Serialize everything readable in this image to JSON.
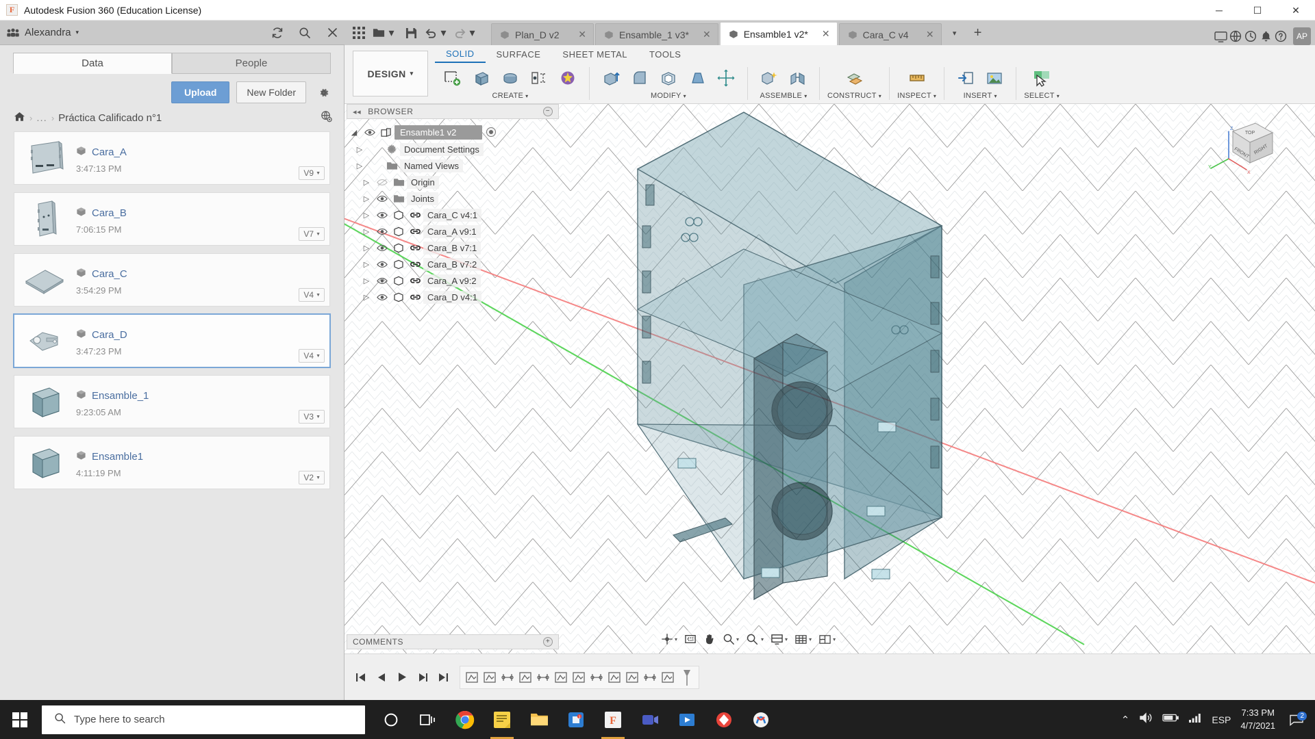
{
  "window": {
    "title": "Autodesk Fusion 360 (Education License)",
    "logo_glyph": "F",
    "minimize": "─",
    "maximize": "☐",
    "close": "✕"
  },
  "appbar": {
    "user_name": "Alexandra",
    "caret": "▾",
    "icons": [
      "refresh-icon",
      "search-icon",
      "close-icon"
    ]
  },
  "datapanel": {
    "tabs": [
      {
        "label": "Data",
        "active": true
      },
      {
        "label": "People",
        "active": false
      }
    ],
    "upload_label": "Upload",
    "new_folder_label": "New Folder",
    "settings_icon": "gear-icon",
    "breadcrumb": {
      "home_icon": "home-icon",
      "ellipsis": "...",
      "current": "Práctica Calificado n°1",
      "separator": "›"
    },
    "files": [
      {
        "name": "Cara_A",
        "time": "3:47:13 PM",
        "version": "V9",
        "selected": false,
        "thumb": "panel-a"
      },
      {
        "name": "Cara_B",
        "time": "7:06:15 PM",
        "version": "V7",
        "selected": false,
        "thumb": "panel-b"
      },
      {
        "name": "Cara_C",
        "time": "3:54:29 PM",
        "version": "V4",
        "selected": false,
        "thumb": "panel-c"
      },
      {
        "name": "Cara_D",
        "time": "3:47:23 PM",
        "version": "V4",
        "selected": true,
        "thumb": "panel-d"
      },
      {
        "name": "Ensamble_1",
        "time": "9:23:05 AM",
        "version": "V3",
        "selected": false,
        "thumb": "box"
      },
      {
        "name": "Ensamble1",
        "time": "4:11:19 PM",
        "version": "V2",
        "selected": false,
        "thumb": "box"
      }
    ]
  },
  "doctabs": {
    "items": [
      {
        "label": "Plan_D v2",
        "active": false,
        "closable": true
      },
      {
        "label": "Ensamble_1 v3*",
        "active": false,
        "closable": true
      },
      {
        "label": "Ensamble1 v2*",
        "active": true,
        "closable": true
      },
      {
        "label": "Cara_C v4",
        "active": false,
        "closable": true
      }
    ],
    "overflow_caret": "▾",
    "add_label": "+",
    "right_icons": [
      "job-status-icon",
      "help-globe-icon",
      "clock-icon",
      "bell-icon",
      "question-icon"
    ],
    "avatar_initials": "AP",
    "grid_icon": "apps-grid-icon",
    "new_icon": "new-design-icon",
    "save_icon": "save-icon",
    "undo_icon": "undo-icon",
    "redo_icon": "redo-icon"
  },
  "ribbon": {
    "workspace_label": "DESIGN",
    "workspace_caret": "▾",
    "tabs": [
      {
        "label": "SOLID",
        "active": true
      },
      {
        "label": "SURFACE",
        "active": false
      },
      {
        "label": "SHEET METAL",
        "active": false
      },
      {
        "label": "TOOLS",
        "active": false
      }
    ],
    "groups": [
      {
        "label": "CREATE",
        "caret": "▾",
        "icons": [
          "new-sketch-icon",
          "extrude-icon",
          "revolve-icon",
          "hole-icon",
          "create-more-icon"
        ]
      },
      {
        "label": "MODIFY",
        "caret": "▾",
        "icons": [
          "press-pull-icon",
          "fillet-icon",
          "shell-icon",
          "draft-icon",
          "move-copy-icon"
        ]
      },
      {
        "label": "ASSEMBLE",
        "caret": "▾",
        "icons": [
          "new-component-icon",
          "joint-icon"
        ]
      },
      {
        "label": "CONSTRUCT",
        "caret": "▾",
        "icons": [
          "offset-plane-icon"
        ]
      },
      {
        "label": "INSPECT",
        "caret": "▾",
        "icons": [
          "measure-icon"
        ]
      },
      {
        "label": "INSERT",
        "caret": "▾",
        "icons": [
          "insert-derive-icon",
          "insert-canvas-icon"
        ]
      },
      {
        "label": "SELECT",
        "caret": "▾",
        "icons": [
          "select-icon"
        ]
      }
    ]
  },
  "browser": {
    "title": "BROWSER",
    "collapse_icon": "◂◂",
    "minimize_glyph": "−",
    "root": {
      "label": "Ensamble1 v2",
      "icon": "assembly-icon",
      "expanded": true
    },
    "nodes": [
      {
        "label": "Document Settings",
        "icon": "gear-icon",
        "eye": false,
        "link": false,
        "indent": 1
      },
      {
        "label": "Named Views",
        "icon": "folder-icon",
        "eye": false,
        "link": false,
        "indent": 1
      },
      {
        "label": "Origin",
        "icon": "folder-icon",
        "eye": true,
        "eye_off": true,
        "link": false,
        "indent": 2
      },
      {
        "label": "Joints",
        "icon": "folder-icon",
        "eye": true,
        "link": false,
        "indent": 2
      },
      {
        "label": "Cara_C v4:1",
        "icon": "body-icon",
        "eye": true,
        "link": true,
        "indent": 2
      },
      {
        "label": "Cara_A v9:1",
        "icon": "body-icon",
        "eye": true,
        "link": true,
        "indent": 2
      },
      {
        "label": "Cara_B v7:1",
        "icon": "body-icon",
        "eye": true,
        "link": true,
        "indent": 2
      },
      {
        "label": "Cara_B v7:2",
        "icon": "body-icon",
        "eye": true,
        "link": true,
        "indent": 2
      },
      {
        "label": "Cara_A v9:2",
        "icon": "body-icon",
        "eye": true,
        "link": true,
        "indent": 2
      },
      {
        "label": "Cara_D v4:1",
        "icon": "body-icon",
        "eye": true,
        "link": true,
        "indent": 2
      }
    ]
  },
  "comments": {
    "title": "COMMENTS",
    "expand_glyph": "+"
  },
  "navbar": {
    "items": [
      "orbit-icon",
      "pan-hand-icon",
      "zoom-icon",
      "fit-icon",
      "display-settings-icon",
      "grid-snap-icon",
      "viewports-icon"
    ],
    "caret": "▾"
  },
  "viewcube": {
    "top_label": "TOP",
    "front_label": "FRONT",
    "right_label": "RIGHT",
    "axis_x": "X",
    "axis_y": "Y",
    "axis_z": "Z"
  },
  "timeline": {
    "controls": [
      "go-to-start-icon",
      "step-back-icon",
      "play-icon",
      "step-forward-icon",
      "go-to-end-icon"
    ],
    "features": [
      "sketch-feature-icon",
      "sketch-feature-icon",
      "joint-feature-icon",
      "sketch-feature-icon",
      "joint-feature-icon",
      "sketch-feature-icon",
      "sketch-feature-icon",
      "joint-feature-icon",
      "sketch-feature-icon",
      "sketch-feature-icon",
      "joint-feature-icon",
      "sketch-feature-icon"
    ],
    "end_marker": "timeline-end-marker"
  },
  "taskbar": {
    "start_icon": "windows-start-icon",
    "search_placeholder": "Type here to search",
    "search_icon": "search-icon",
    "apps": [
      {
        "name": "cortana-icon",
        "active": false
      },
      {
        "name": "task-view-icon",
        "active": false
      },
      {
        "name": "chrome-icon",
        "active": false
      },
      {
        "name": "sticky-notes-icon",
        "active": true
      },
      {
        "name": "file-explorer-icon",
        "active": false
      },
      {
        "name": "store-icon",
        "active": false
      },
      {
        "name": "fusion360-icon",
        "active": true
      },
      {
        "name": "teams-icon",
        "active": false
      },
      {
        "name": "movies-tv-icon",
        "active": false
      },
      {
        "name": "autodesk-icon",
        "active": false
      },
      {
        "name": "slicer-icon",
        "active": false
      }
    ],
    "tray": {
      "chevron": "⌃",
      "volume_icon": "volume-icon",
      "battery_icon": "battery-icon",
      "network_icon": "network-icon",
      "language": "ESP",
      "time": "7:33 PM",
      "date": "4/7/2021",
      "notification_icon": "notification-icon",
      "notification_count": "2"
    }
  },
  "colors": {
    "accent_blue": "#1d71b8",
    "upload_blue": "#6d9ed4",
    "link_blue": "#4a6ea0",
    "model_teal": "#2f6b78",
    "axis_red": "#ff6b6b",
    "axis_green": "#4ce04c",
    "taskbar_bg": "#1f1f1f"
  }
}
